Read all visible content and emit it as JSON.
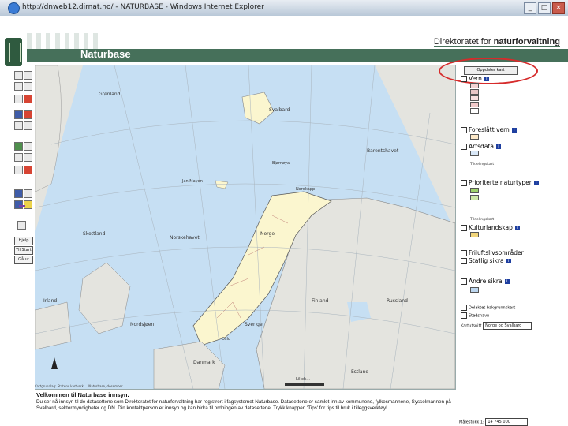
{
  "window": {
    "title": "http://dnweb12.dirnat.no/ - NATURBASE - Windows Internet Explorer",
    "btn_min": "_",
    "btn_max": "□",
    "btn_close": "×"
  },
  "header": {
    "app_title": "Naturbase",
    "direktorat_prefix": "Direktoratet for ",
    "direktorat_bold": "naturforvaltning"
  },
  "toolbar": {
    "hjelp": "Hjelp",
    "tilstart": "Til Start",
    "gaa_ut": "Gå ut"
  },
  "legend": {
    "update_button": "Oppdater kart",
    "layers": [
      {
        "label": "Vern"
      },
      {
        "label": "Foreslått vern"
      },
      {
        "label": "Artsdata"
      },
      {
        "label": "Prioriterte naturtyper"
      },
      {
        "label": "Kulturlandskap"
      },
      {
        "label": "Friluftslivsområder"
      },
      {
        "label": "Statlig sikra"
      },
      {
        "label": "Andre sikra"
      }
    ],
    "sublabels": {
      "tildelingskart1": "Tildelingskart",
      "tildelingskart2": "Tildelingskart",
      "delaktet": "Delaktet bakgrunnskart",
      "stedsnavn": "Stedsnavn"
    },
    "utsnitt_label": "Kartutsnitt",
    "utsnitt_value": "Norge og Svalbard"
  },
  "map": {
    "labels": {
      "gronland": "Grønland",
      "svalbard": "Svalbard",
      "bjornoya": "Bjørnøya",
      "jan_mayen": "Jan Mayen",
      "norskehavet": "Norskehavet",
      "nordsjoen": "Nordsjøen",
      "skottland": "Skottland",
      "danmark": "Danmark",
      "sverige": "Sverige",
      "finland": "Finland",
      "russland": "Russland",
      "barentshavet": "Barentshavet",
      "oslo": "Oslo",
      "irland": "Irland",
      "estland": "Estland",
      "norge": "Norge",
      "nordkapp": "Nordkapp"
    },
    "scale_text": "Lilleh...",
    "credit": "Kartgrunnlag: Statens kartverk ... Naturbase, desember"
  },
  "welcome": {
    "title": "Velkommen til Naturbase innsyn.",
    "body": "Du ser nå innsyn til de datasettene som Direktoratet for naturforvaltning har registrert i fagsystemet Naturbase. Datasettene er samlet inn av kommunene, fylkesmannene, Sysselmannen på Svalbard, sektormyndigheter og DN. Din kontaktperson er innsyn og kan bidra til ordningen av datasettene. Trykk knappen 'Tips' for tips til bruk i tilleggsverktøy!"
  },
  "maalestokk": {
    "label": "Målestokk 1:",
    "value": "14 745 000"
  },
  "colors": {
    "sea": "#c6dff3",
    "land": "#e4e4df",
    "norway": "#fbf6cf",
    "header_green": "#46705a",
    "highlight": "#d62b2b"
  }
}
